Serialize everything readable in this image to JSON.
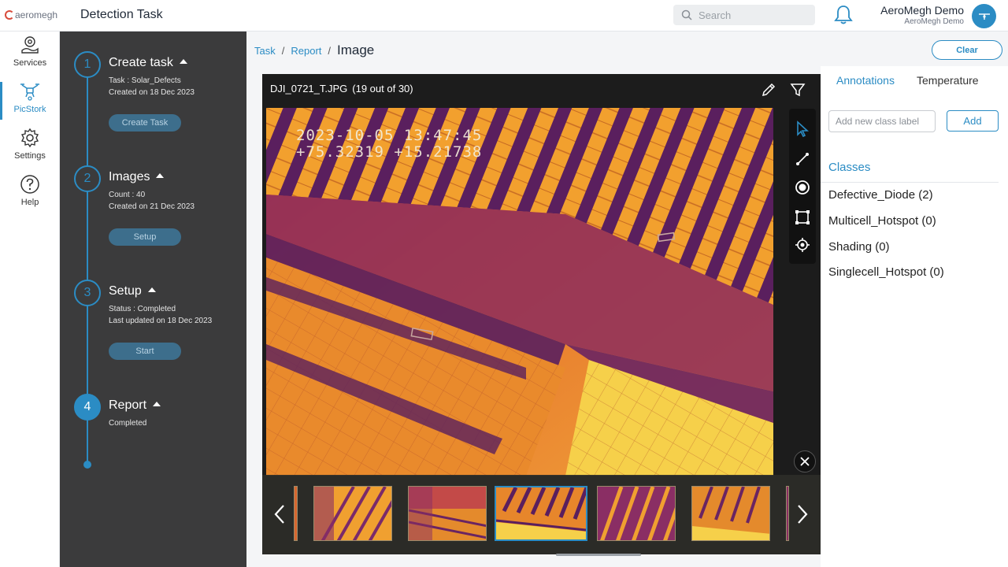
{
  "header": {
    "logo": "aeromegh",
    "title": "Detection Task",
    "search_placeholder": "Search",
    "user_name": "AeroMegh Demo",
    "user_org": "AeroMegh Demo"
  },
  "nav": {
    "items": [
      {
        "label": "Services",
        "icon": "services-icon"
      },
      {
        "label": "PicStork",
        "icon": "drone-icon",
        "active": true
      },
      {
        "label": "Settings",
        "icon": "gear-icon"
      },
      {
        "label": "Help",
        "icon": "help-icon"
      }
    ]
  },
  "steps": [
    {
      "num": "1",
      "title": "Create task",
      "line1": "Task : Solar_Defects",
      "line2": "Created on 18 Dec 2023",
      "button": "Create Task"
    },
    {
      "num": "2",
      "title": "Images",
      "line1": "Count : 40",
      "line2": "Created on 21 Dec 2023",
      "button": "Setup"
    },
    {
      "num": "3",
      "title": "Setup",
      "line1": "Status : Completed",
      "line2": "Last updated on 18 Dec 2023",
      "button": "Start"
    },
    {
      "num": "4",
      "title": "Report",
      "line1": "Completed"
    }
  ],
  "breadcrumb": {
    "task": "Task",
    "report": "Report",
    "current": "Image",
    "sep": "/"
  },
  "actions": {
    "clear": "Clear"
  },
  "viewer": {
    "filename": "DJI_0721_T.JPG",
    "position": "(19 out of 30)",
    "stamp_line1": "2023-10-05 13:47:45",
    "stamp_line2": "+75.32319 +15.21738"
  },
  "panel": {
    "tab_annotations": "Annotations",
    "tab_temperature": "Temperature",
    "class_placeholder": "Add new class label",
    "add_label": "Add",
    "classes_title": "Classes",
    "classes": [
      "Defective_Diode (2)",
      "Multicell_Hotspot (0)",
      "Shading (0)",
      "Singlecell_Hotspot (0)"
    ]
  },
  "colors": {
    "accent": "#2b8cc4",
    "sidebar": "#3b3b3c",
    "viewer": "#1c1c1c"
  }
}
